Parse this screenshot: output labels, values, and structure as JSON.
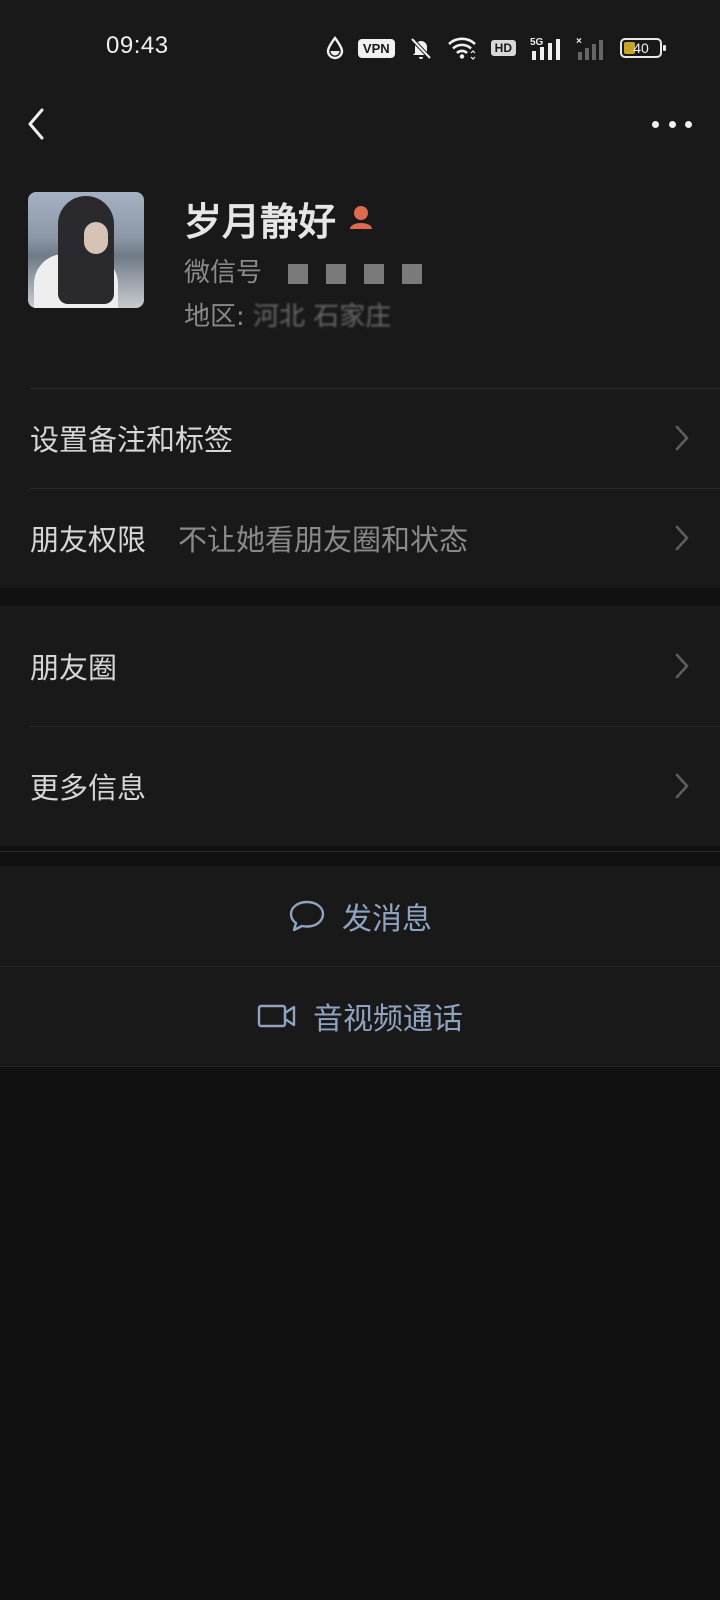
{
  "status_bar": {
    "time": "09:43",
    "vpn": "VPN",
    "hd": "HD",
    "network": "5G",
    "battery": "40",
    "battery_level_percent": 40,
    "icons": [
      "drop-icon",
      "vpn-badge",
      "bell-off-icon",
      "wifi-icon",
      "hd-badge",
      "signal-5g-icon",
      "signal-no-service-icon",
      "battery-icon"
    ]
  },
  "nav": {
    "back_icon": "chevron-left-icon",
    "more_icon": "more-dots-icon"
  },
  "profile": {
    "name": "岁月静好",
    "gender_icon": "female-icon",
    "wechat_id_label": "微信号",
    "region_label": "地区:",
    "region_value": "河北 石家庄"
  },
  "section1": {
    "items": [
      {
        "label": "设置备注和标签"
      },
      {
        "label": "朋友权限",
        "value": "不让她看朋友圈和状态"
      }
    ]
  },
  "section2": {
    "items": [
      {
        "label": "朋友圈"
      },
      {
        "label": "更多信息"
      }
    ]
  },
  "actions": {
    "message": {
      "label": "发消息",
      "icon": "chat-bubble-icon"
    },
    "call": {
      "label": "音视频通话",
      "icon": "video-camera-icon"
    }
  },
  "colors": {
    "background": "#111111",
    "panel": "#191919",
    "action_blue": "#8fa3c0",
    "gender_icon": "#e06a4e",
    "battery_fill": "#c8a52a"
  }
}
